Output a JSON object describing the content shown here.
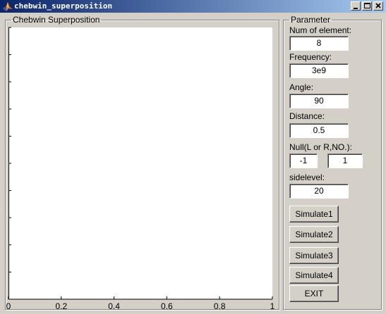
{
  "window": {
    "title": "chebwin_superposition"
  },
  "plot_panel": {
    "legend": "Chebwin Superposition"
  },
  "chart_data": {
    "type": "line",
    "x_ticks": [
      "0",
      "0.2",
      "0.4",
      "0.6",
      "0.8",
      "1"
    ],
    "xlim": [
      0,
      1
    ],
    "ylim": [
      0,
      1
    ],
    "series": []
  },
  "parameter_panel": {
    "legend": "Parameter",
    "num_label": "Num of element:",
    "num_value": "8",
    "freq_label": "Frequency:",
    "freq_value": "3e9",
    "angle_label": "Angle:",
    "angle_value": "90",
    "distance_label": "Distance:",
    "distance_value": "0.5",
    "null_label": "Null(L or R,NO.):",
    "null_lr_value": "-1",
    "null_no_value": "1",
    "sidelevel_label": "sidelevel:",
    "sidelevel_value": "20"
  },
  "buttons": {
    "simulate1": "Simulate1",
    "simulate2": "Simulate2",
    "simulate3": "Simulate3",
    "simulate4": "Simulate4",
    "exit": "EXIT"
  }
}
